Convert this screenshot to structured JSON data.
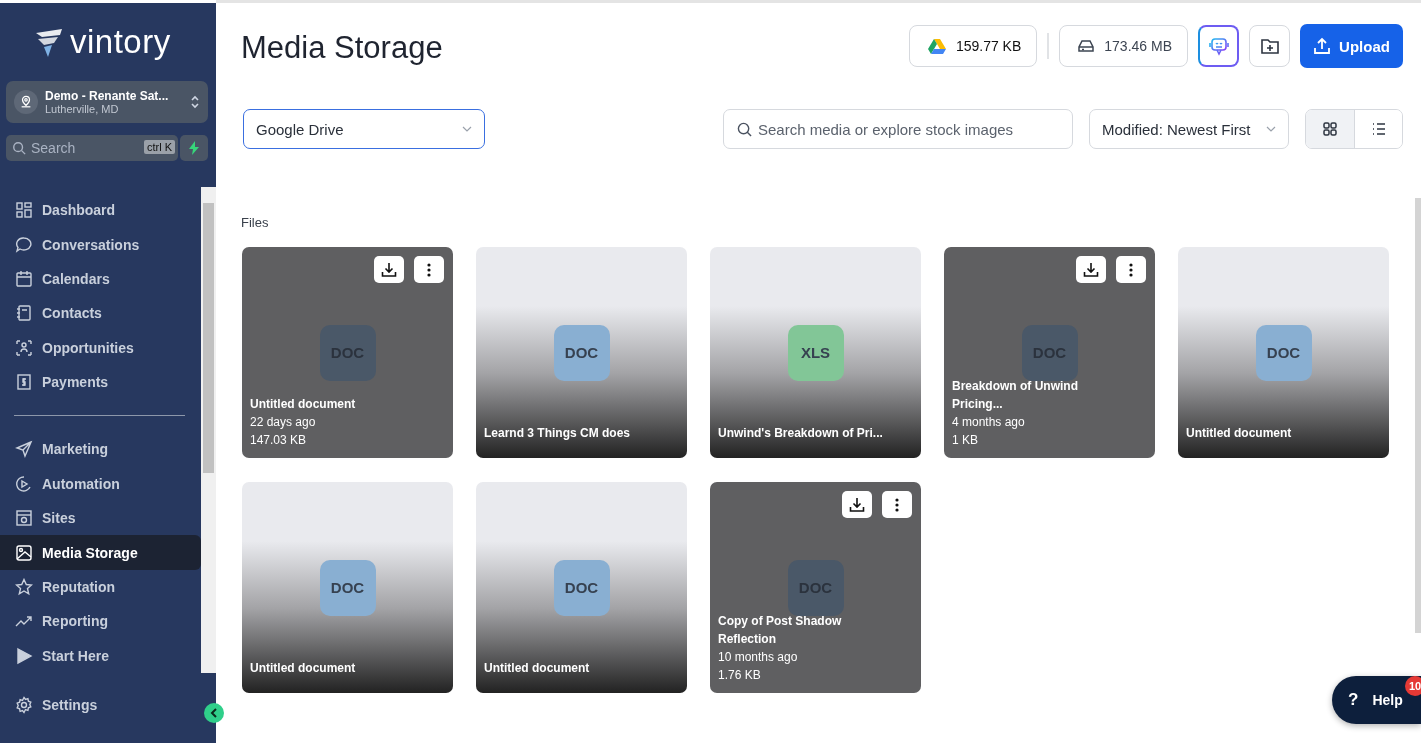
{
  "sidebar": {
    "logo": "vintory",
    "account": {
      "name": "Demo - Renante Sat...",
      "location": "Lutherville, MD"
    },
    "search": {
      "placeholder": "Search",
      "shortcut": "ctrl K"
    },
    "nav_groups": [
      [
        {
          "label": "Dashboard",
          "selected": false
        },
        {
          "label": "Conversations",
          "selected": false
        },
        {
          "label": "Calendars",
          "selected": false
        },
        {
          "label": "Contacts",
          "selected": false
        },
        {
          "label": "Opportunities",
          "selected": false
        },
        {
          "label": "Payments",
          "selected": false
        }
      ],
      [
        {
          "label": "Marketing",
          "selected": false
        },
        {
          "label": "Automation",
          "selected": false
        },
        {
          "label": "Sites",
          "selected": false
        },
        {
          "label": "Media Storage",
          "selected": true
        },
        {
          "label": "Reputation",
          "selected": false
        },
        {
          "label": "Reporting",
          "selected": false
        },
        {
          "label": "Start Here",
          "selected": false
        }
      ]
    ],
    "settings": {
      "label": "Settings"
    }
  },
  "header": {
    "title": "Media Storage",
    "storage": [
      {
        "kind": "drive",
        "value": "159.77 KB"
      },
      {
        "kind": "disk",
        "value": "173.46 MB"
      }
    ],
    "upload_label": "Upload"
  },
  "filters": {
    "source": {
      "value": "Google Drive"
    },
    "search": {
      "placeholder": "Search media or explore stock images"
    },
    "sort": {
      "value": "Modified: Newest First"
    },
    "view_modes": [
      {
        "kind": "grid",
        "selected": true
      },
      {
        "kind": "list",
        "selected": false
      }
    ]
  },
  "files_label": "Files",
  "files": [
    {
      "title": "Untitled document",
      "type": "DOC",
      "kind": "doc",
      "hovered": true,
      "date": "22 days ago",
      "size": "147.03 KB"
    },
    {
      "title": "Learnd 3 Things CM does",
      "type": "DOC",
      "kind": "doc",
      "hovered": false
    },
    {
      "title": "Unwind's Breakdown of Pri...",
      "type": "XLS",
      "kind": "xls",
      "hovered": false
    },
    {
      "title": "Breakdown of Unwind Pricing...",
      "type": "DOC",
      "kind": "doc",
      "hovered": true,
      "date": "4 months ago",
      "size": "1 KB"
    },
    {
      "title": "Untitled document",
      "type": "DOC",
      "kind": "doc",
      "hovered": false
    },
    {
      "title": "Untitled document",
      "type": "DOC",
      "kind": "doc",
      "hovered": false
    },
    {
      "title": "Untitled document",
      "type": "DOC",
      "kind": "doc",
      "hovered": false
    },
    {
      "title": "Copy of Post Shadow Reflection",
      "type": "DOC",
      "kind": "doc",
      "hovered": true,
      "date": "10 months ago",
      "size": "1.76 KB"
    }
  ],
  "help": {
    "icon": "?",
    "label": "Help",
    "badge": "10"
  }
}
